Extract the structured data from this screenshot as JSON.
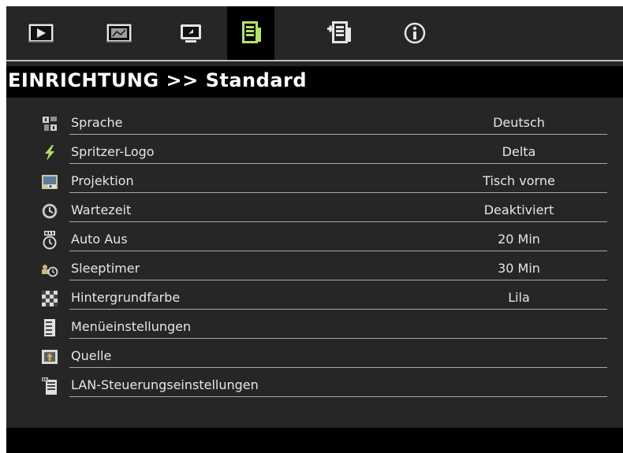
{
  "tabs": [
    {
      "icon": "picture-icon"
    },
    {
      "icon": "display-icon"
    },
    {
      "icon": "setup-basic-icon"
    },
    {
      "icon": "setup-standard-icon"
    },
    {
      "icon": "setup-advanced-icon"
    },
    {
      "icon": "info-icon"
    }
  ],
  "active_tab_index": 3,
  "title": "EINRICHTUNG >> Standard",
  "menu": {
    "items": [
      {
        "icon": "language-icon",
        "label": "Sprache",
        "value": "Deutsch"
      },
      {
        "icon": "splash-logo-icon",
        "label": "Spritzer-Logo",
        "value": "Delta"
      },
      {
        "icon": "projection-icon",
        "label": "Projektion",
        "value": "Tisch vorne"
      },
      {
        "icon": "screensaver-clock-icon",
        "label": "Wartezeit",
        "value": "Deaktiviert"
      },
      {
        "icon": "auto-off-icon",
        "label": "Auto Aus",
        "value": "20 Min"
      },
      {
        "icon": "sleep-timer-icon",
        "label": "Sleeptimer",
        "value": "30 Min"
      },
      {
        "icon": "background-color-icon",
        "label": "Hintergrundfarbe",
        "value": "Lila"
      },
      {
        "icon": "menu-settings-icon",
        "label": "Menüeinstellungen",
        "value": ""
      },
      {
        "icon": "source-icon",
        "label": "Quelle",
        "value": ""
      },
      {
        "icon": "lan-control-icon",
        "label": "LAN-Steuerungseinstellungen",
        "value": ""
      }
    ]
  },
  "colors": {
    "panel": "#262626",
    "bar": "#000000",
    "text": "#e6e6e6",
    "active_icon": "#b6e26a"
  }
}
